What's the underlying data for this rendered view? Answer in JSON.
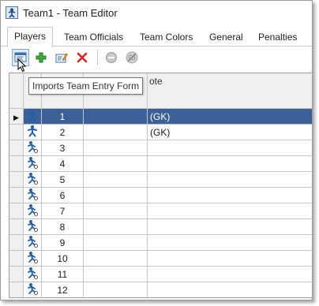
{
  "window": {
    "title": "Team1 - Team Editor"
  },
  "tabs": [
    {
      "label": "Players",
      "active": true
    },
    {
      "label": "Team Officials"
    },
    {
      "label": "Team Colors"
    },
    {
      "label": "General"
    },
    {
      "label": "Penalties"
    }
  ],
  "toolbar": {
    "buttons": [
      {
        "icon": "import-form-icon",
        "active": true
      },
      {
        "icon": "add-icon"
      },
      {
        "icon": "edit-icon"
      },
      {
        "icon": "delete-icon"
      },
      {
        "icon": "remove-disabled-icon"
      },
      {
        "icon": "unlink-disabled-icon"
      }
    ]
  },
  "tooltip": {
    "text": "Imports Team Entry Form"
  },
  "grid": {
    "note_header_visible": "ote",
    "rows": [
      {
        "num": "1",
        "note": "(GK)",
        "selected": true,
        "icon": "player-active-icon"
      },
      {
        "num": "2",
        "note": "(GK)",
        "icon": "player-active-icon"
      },
      {
        "num": "3",
        "note": "",
        "icon": "player-icon"
      },
      {
        "num": "4",
        "note": "",
        "icon": "player-icon"
      },
      {
        "num": "5",
        "note": "",
        "icon": "player-icon"
      },
      {
        "num": "6",
        "note": "",
        "icon": "player-icon"
      },
      {
        "num": "7",
        "note": "",
        "icon": "player-icon"
      },
      {
        "num": "8",
        "note": "",
        "icon": "player-icon"
      },
      {
        "num": "9",
        "note": "",
        "icon": "player-icon"
      },
      {
        "num": "10",
        "note": "",
        "icon": "player-icon"
      },
      {
        "num": "11",
        "note": "",
        "icon": "player-icon"
      },
      {
        "num": "12",
        "note": "",
        "icon": "player-icon"
      }
    ]
  },
  "colors": {
    "accent": "#3b5f97"
  }
}
